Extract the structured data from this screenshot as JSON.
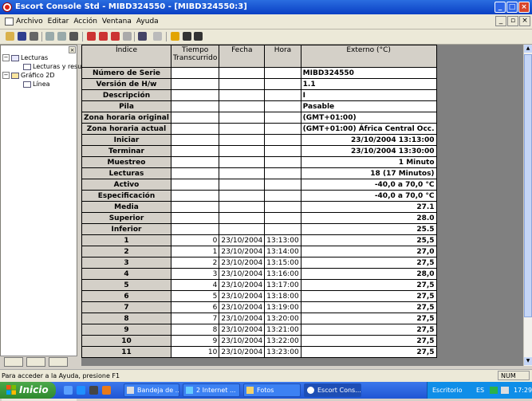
{
  "window": {
    "title": "Escort Console Std - MIBD324550 - [MIBD324550:3]"
  },
  "menu": [
    "Archivo",
    "Editar",
    "Acción",
    "Ventana",
    "Ayuda"
  ],
  "tree": {
    "nodes": [
      "Lecturas",
      "Lecturas y resu",
      "Gráfico 2D",
      "Línea"
    ]
  },
  "table": {
    "headers": [
      "Índice",
      "Tiempo Transcurrido",
      "Fecha",
      "Hora",
      "Externo (°C)"
    ],
    "summary": [
      {
        "label": "Número de Serie",
        "value": "MIBD324550"
      },
      {
        "label": "Versión de H/w",
        "value": "1.1"
      },
      {
        "label": "Descripción",
        "value": "I"
      },
      {
        "label": "Pila",
        "value": "Pasable"
      },
      {
        "label": "Zona horaria original",
        "value": "(GMT+01:00)"
      },
      {
        "label": "Zona horaria actual",
        "value": "(GMT+01:00) África Central Occ."
      },
      {
        "label": "Iniciar",
        "value": "23/10/2004  13:13:00"
      },
      {
        "label": "Terminar",
        "value": "23/10/2004  13:30:00"
      },
      {
        "label": "Muestreo",
        "value": "1 Minuto"
      },
      {
        "label": "Lecturas",
        "value": "18 (17 Minutos)"
      },
      {
        "label": "Activo",
        "value": "-40,0 a 70,0 °C"
      },
      {
        "label": "Especificación",
        "value": "-40,0 a 70,0 °C"
      },
      {
        "label": "Media",
        "value": "27.1"
      },
      {
        "label": "Superior",
        "value": "28.0"
      },
      {
        "label": "Inferior",
        "value": "25.5"
      }
    ],
    "readings": [
      {
        "index": "1",
        "elapsed": "0",
        "date": "23/10/2004",
        "time": "13:13:00",
        "value": "25,5"
      },
      {
        "index": "2",
        "elapsed": "1",
        "date": "23/10/2004",
        "time": "13:14:00",
        "value": "27,0"
      },
      {
        "index": "3",
        "elapsed": "2",
        "date": "23/10/2004",
        "time": "13:15:00",
        "value": "27,5"
      },
      {
        "index": "4",
        "elapsed": "3",
        "date": "23/10/2004",
        "time": "13:16:00",
        "value": "28,0"
      },
      {
        "index": "5",
        "elapsed": "4",
        "date": "23/10/2004",
        "time": "13:17:00",
        "value": "27,5"
      },
      {
        "index": "6",
        "elapsed": "5",
        "date": "23/10/2004",
        "time": "13:18:00",
        "value": "27,5"
      },
      {
        "index": "7",
        "elapsed": "6",
        "date": "23/10/2004",
        "time": "13:19:00",
        "value": "27,5"
      },
      {
        "index": "8",
        "elapsed": "7",
        "date": "23/10/2004",
        "time": "13:20:00",
        "value": "27,5"
      },
      {
        "index": "9",
        "elapsed": "8",
        "date": "23/10/2004",
        "time": "13:21:00",
        "value": "27,5"
      },
      {
        "index": "10",
        "elapsed": "9",
        "date": "23/10/2004",
        "time": "13:22:00",
        "value": "27,5"
      },
      {
        "index": "11",
        "elapsed": "10",
        "date": "23/10/2004",
        "time": "13:23:00",
        "value": "27,5"
      }
    ]
  },
  "status": {
    "message": "Para acceder a la Ayuda, presione F1",
    "num": "NUM"
  },
  "taskbar": {
    "start": "Inicio",
    "tasks": [
      "Bandeja de ...",
      "2 Internet ...",
      "Fotos",
      "Escort Cons..."
    ],
    "tray_desktop": "Escritorio",
    "lang": "ES",
    "clock": "17:29"
  },
  "colors": {
    "title_bar": "#0a3fc4",
    "taskbar": "#245edb",
    "start": "#3c9a3a",
    "grid_header": "#d4d0c8"
  }
}
